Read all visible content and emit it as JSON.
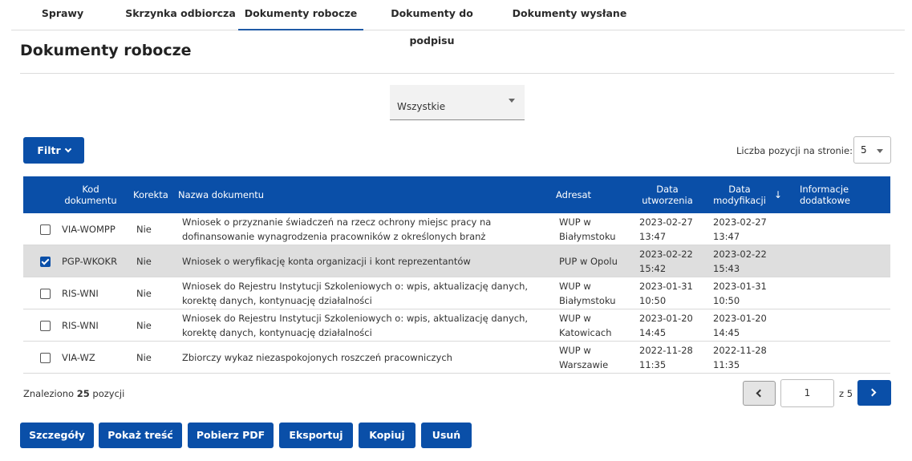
{
  "tabs": [
    "Sprawy",
    "Skrzynka odbiorcza",
    "Dokumenty robocze",
    "Dokumenty do podpisu",
    "Dokumenty wysłane"
  ],
  "active_tab": "Dokumenty robocze",
  "page_title": "Dokumenty robocze",
  "status_select": {
    "value": "Wszystkie"
  },
  "filter_button": "Filtr",
  "per_page": {
    "label": "Liczba pozycji na stronie:",
    "value": "5"
  },
  "table": {
    "headers": {
      "code": "Kod dokumentu",
      "correction": "Korekta",
      "name": "Nazwa dokumentu",
      "addressee": "Adresat",
      "created": "Data utworzenia",
      "modified": "Data modyfikacji",
      "info": "Informacje dodatkowe"
    },
    "sort_icon": "arrow-down-icon",
    "rows": [
      {
        "checked": false,
        "code": "VIA-WOMPP",
        "correction": "Nie",
        "name": "Wniosek o przyznanie świadczeń na rzecz ochrony miejsc pracy na dofinansowanie wynagrodzenia pracowników z określonych branż",
        "addressee": "WUP w Białymstoku",
        "created": "2023-02-27 13:47",
        "modified": "2023-02-27 13:47",
        "info": ""
      },
      {
        "checked": true,
        "code": "PGP-WKOKR",
        "correction": "Nie",
        "name": "Wniosek o weryfikację konta organizacji i kont reprezentantów",
        "addressee": "PUP w Opolu",
        "created": "2023-02-22 15:42",
        "modified": "2023-02-22 15:43",
        "info": ""
      },
      {
        "checked": false,
        "code": "RIS-WNI",
        "correction": "Nie",
        "name": "Wniosek do Rejestru Instytucji Szkoleniowych o: wpis, aktualizację danych, korektę danych, kontynuację działalności",
        "addressee": "WUP w Białymstoku",
        "created": "2023-01-31 10:50",
        "modified": "2023-01-31 10:50",
        "info": ""
      },
      {
        "checked": false,
        "code": "RIS-WNI",
        "correction": "Nie",
        "name": "Wniosek do Rejestru Instytucji Szkoleniowych o: wpis, aktualizację danych, korektę danych, kontynuację działalności",
        "addressee": "WUP w Katowicach",
        "created": "2023-01-20 14:45",
        "modified": "2023-01-20 14:45",
        "info": ""
      },
      {
        "checked": false,
        "code": "VIA-WZ",
        "correction": "Nie",
        "name": "Zbiorczy wykaz niezaspokojonych roszczeń pracowniczych",
        "addressee": "WUP w Warszawie",
        "created": "2022-11-28 11:35",
        "modified": "2022-11-28 11:35",
        "info": ""
      }
    ]
  },
  "found": {
    "prefix": "Znaleziono",
    "count": "25",
    "suffix": "pozycji"
  },
  "pagination": {
    "current_page": "1",
    "of_text": "z 5"
  },
  "actions": [
    "Szczegóły",
    "Pokaż treść",
    "Pobierz PDF",
    "Eksportuj",
    "Kopiuj",
    "Usuń"
  ],
  "colors": {
    "primary": "#0a4fa8",
    "selected_row": "#dedede"
  }
}
